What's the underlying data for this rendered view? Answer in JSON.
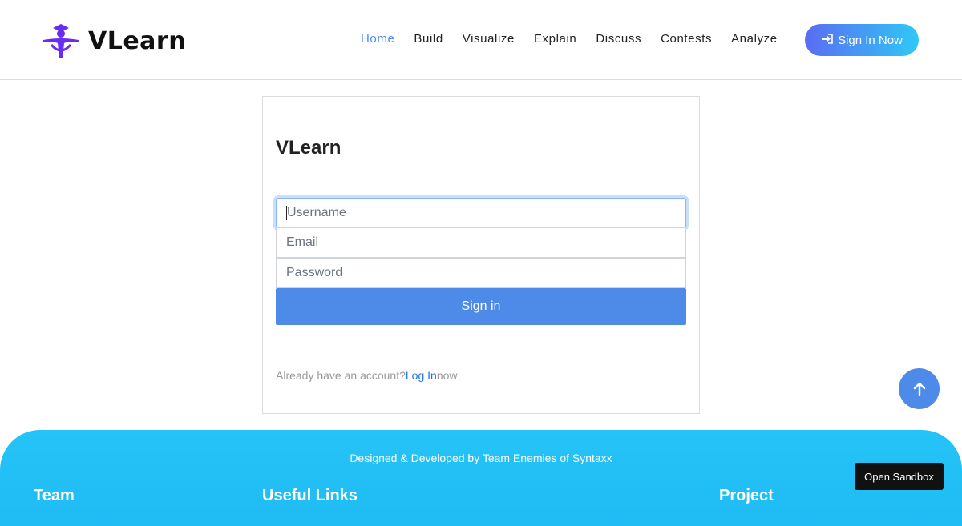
{
  "brand": {
    "name": "VLearn",
    "logo_icon": "graduate-figure-icon",
    "logo_color": "#6a2cf5"
  },
  "nav": {
    "items": [
      {
        "label": "Home",
        "active": true
      },
      {
        "label": "Build"
      },
      {
        "label": "Visualize"
      },
      {
        "label": "Explain"
      },
      {
        "label": "Discuss"
      },
      {
        "label": "Contests"
      },
      {
        "label": "Analyze"
      }
    ],
    "signin_label": "Sign In Now",
    "signin_icon": "sign-in-icon"
  },
  "form": {
    "title": "VLearn",
    "username_placeholder": "Username",
    "email_placeholder": "Email",
    "password_placeholder": "Password",
    "submit_label": "Sign in",
    "already_text": "Already have an account?",
    "login_link": "Log In",
    "now_text": "now"
  },
  "footer": {
    "credit": "Designed & Developed by Team Enemies of Syntaxx",
    "headings": {
      "team": "Team",
      "links": "Useful Links",
      "project": "Project"
    }
  },
  "scroll_top_icon": "arrow-up-icon",
  "sandbox_label": "Open Sandbox",
  "colors": {
    "accent": "#4e8be8",
    "link": "#1a73e8",
    "footer_bg": "#22c0f6"
  }
}
